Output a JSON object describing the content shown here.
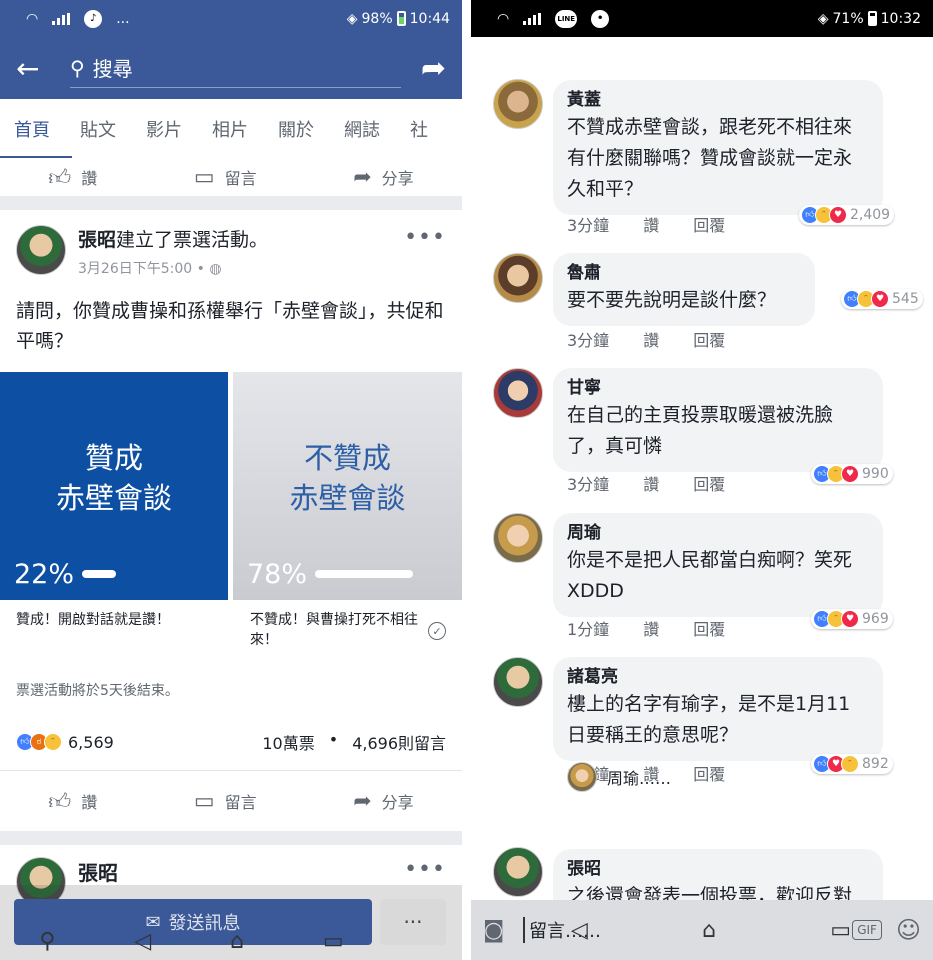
{
  "left": {
    "status": {
      "battery": "98%",
      "time": "10:44",
      "more": "..."
    },
    "search": {
      "placeholder": "搜尋"
    },
    "tabs": [
      "首頁",
      "貼文",
      "影片",
      "相片",
      "關於",
      "網誌",
      "社"
    ],
    "top_actions": {
      "like": "讚",
      "comment": "留言",
      "share": "分享"
    },
    "post": {
      "author": "張昭",
      "action": "建立了票選活動。",
      "time": "3月26日下午5:00",
      "text": "請問，你贊成曹操和孫權舉行「赤壁會談」，共促和平嗎？",
      "poll": {
        "option_a": {
          "line1": "贊成",
          "line2": "赤壁會談",
          "percent": "22%",
          "caption": "贊成！開啟對話就是讚！"
        },
        "option_b": {
          "line1": "不贊成",
          "line2": "赤壁會談",
          "percent": "78%",
          "caption": "不贊成！與曹操打死不相往來！"
        }
      },
      "poll_end": "票選活動將於5天後結束。",
      "reactions_count": "6,569",
      "votes": "10萬票",
      "comments": "4,696則留言",
      "actions": {
        "like": "讚",
        "comment": "留言",
        "share": "分享"
      }
    },
    "post2": {
      "author": "張昭"
    },
    "messenger": {
      "label": "發送訊息",
      "more": "···"
    }
  },
  "right": {
    "status": {
      "battery": "71%",
      "time": "10:32",
      "more": "..."
    },
    "comments": [
      {
        "name": "黃蓋",
        "text": "不贊成赤壁會談，跟老死不相往來有什麼關聯嗎？贊成會談就一定永久和平？",
        "time": "3分鐘",
        "like": "讚",
        "reply": "回覆",
        "count": "2,409"
      },
      {
        "name": "魯肅",
        "text": "要不要先說明是談什麼？",
        "time": "3分鐘",
        "like": "讚",
        "reply": "回覆",
        "count": "545"
      },
      {
        "name": "甘寧",
        "text": "在自己的主頁投票取暖還被洗臉了，真可憐",
        "time": "3分鐘",
        "like": "讚",
        "reply": "回覆",
        "count": "990"
      },
      {
        "name": "周瑜",
        "text": "你是不是把人民都當白痴啊？笑死XDDD",
        "time": "1分鐘",
        "like": "讚",
        "reply": "回覆",
        "count": "969"
      },
      {
        "name": "諸葛亮",
        "text": "樓上的名字有瑜字，是不是1月11日要稱王的意思呢？",
        "time": "1分鐘",
        "like": "讚",
        "reply": "回覆",
        "count": "892"
      },
      {
        "name": "張昭",
        "text": "之後還會發表一個投票，歡迎反對的朋友來灌票"
      }
    ],
    "reply_preview": "周瑜……",
    "composer": {
      "placeholder": "留言……",
      "gif": "GIF"
    }
  },
  "colors": {
    "fb_blue": "#3b5998",
    "poll_blue": "#0d4fa3",
    "like_blue": "#4080ff"
  }
}
